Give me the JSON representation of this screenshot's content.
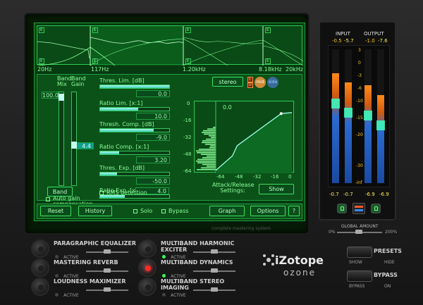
{
  "spectrum": {
    "freq_labels": [
      "20Hz",
      "117Hz",
      "1.20kHz",
      "8.18kHz",
      "20kHz"
    ],
    "band_tags": [
      "E",
      "E",
      "E",
      "E",
      "E",
      "E",
      "E",
      "E"
    ]
  },
  "band_controls": {
    "band_mix_label": "Band Mix",
    "band_gain_label": "Band Gain",
    "band_mix_value": "100.0",
    "band_gain_value": "4.4",
    "auto_gain_label": "Auto gain compensation",
    "band_button": "Band"
  },
  "dynamics": {
    "thres_lim_label": "Thres. Lim. [dB]",
    "thres_lim_value": "0.0",
    "ratio_lim_label": "Ratio Lim. [x:1]",
    "ratio_lim_value": "10.0",
    "thres_comp_label": "Thresh. Comp. [dB]",
    "thres_comp_value": "-9.0",
    "ratio_comp_label": "Ratio Comp. [x:1]",
    "ratio_comp_value": "3.20",
    "thres_exp_label": "Thres. Exp. [dB]",
    "thres_exp_value": "-50.0",
    "ratio_exp_label": "Ratio Exp. [x:1]",
    "ratio_exp_value": "4.0",
    "rms_label": "RMS detection"
  },
  "stereo": {
    "stereo_button": "stereo",
    "mode_tags": [
      "E",
      "B"
    ],
    "ms_tags": [
      "mid",
      "side"
    ],
    "mid_label": "mid"
  },
  "graph": {
    "readout": "0.0",
    "y_ticks": [
      "0",
      "-16",
      "-32",
      "-48",
      "-64"
    ],
    "x_ticks": [
      "-64",
      "-48",
      "-32",
      "-16",
      "0"
    ],
    "attack_label": "Attack/Release Settings:",
    "show_button": "Show"
  },
  "bottom_bar": {
    "reset": "Reset",
    "history": "History",
    "solo": "Solo",
    "bypass": "Bypass",
    "graph": "Graph",
    "options": "Options",
    "help": "?"
  },
  "tagline": "complete mastering system",
  "meters": {
    "input_label": "INPUT",
    "output_label": "OUTPUT",
    "input_peaks": [
      "-0.5",
      "-5.7"
    ],
    "output_peaks": [
      "-1.0",
      "-7.6"
    ],
    "scale": [
      "3",
      "0",
      "-3",
      "-6",
      "-10",
      "-15",
      "-20",
      "-30",
      "-inf"
    ],
    "input_rms": [
      "-0.7",
      "-0.7"
    ],
    "output_rms": [
      "-6.9",
      "-6.9"
    ],
    "input_levels": [
      0.82,
      0.75
    ],
    "output_levels": [
      0.73,
      0.66
    ]
  },
  "global": {
    "amount_label": "GLOBAL AMOUNT",
    "min": "0%",
    "max": "200%"
  },
  "modules_left": [
    {
      "name": "PARAGRAPHIC EQUALIZER",
      "active_label": "ACTIVE",
      "on": false
    },
    {
      "name": "MASTERING REVERB",
      "active_label": "ACTIVE",
      "on": false
    },
    {
      "name": "LOUDNESS MAXIMIZER",
      "active_label": "ACTIVE",
      "on": false
    }
  ],
  "modules_right": [
    {
      "name": "MULTIBAND HARMONIC EXCITER",
      "active_label": "ACTIVE",
      "on": true
    },
    {
      "name": "MULTIBAND DYNAMICS",
      "active_label": "ACTIVE",
      "on": true
    },
    {
      "name": "MULTIBAND STEREO IMAGING",
      "active_label": "ACTIVE",
      "on": false
    }
  ],
  "brand": {
    "name": "iZotope",
    "product": "ozone"
  },
  "presets": {
    "presets_label": "PRESETS",
    "show": "SHOW",
    "hide": "HIDE",
    "bypass_label": "BYPASS",
    "bypass_side": "BYPASS",
    "on": "ON"
  }
}
